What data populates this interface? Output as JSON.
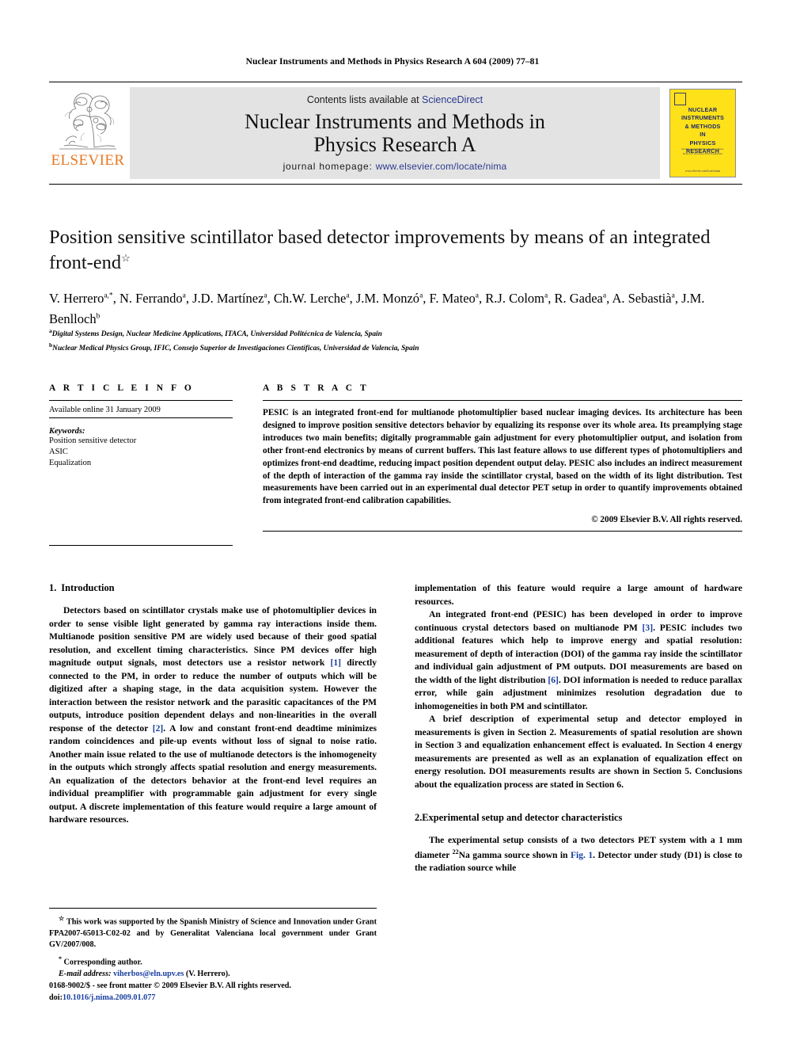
{
  "running_head": "Nuclear Instruments and Methods in Physics Research A 604 (2009) 77–81",
  "masthead": {
    "contents_prefix": "Contents lists available at",
    "sciencedirect": "ScienceDirect",
    "journal_title_line1": "Nuclear Instruments and Methods in",
    "journal_title_line2": "Physics Research A",
    "homepage_label": "journal homepage:",
    "homepage_url": "www.elsevier.com/locate/nima",
    "publisher": "ELSEVIER",
    "cover": {
      "title_line1": "NUCLEAR",
      "title_line2": "INSTRUMENTS",
      "title_line3": "& METHODS",
      "title_line4": "IN",
      "title_line5": "PHYSICS",
      "title_line6": "RESEARCH",
      "subtitle_line1": "Section A: Accelerators, Spectrometers,",
      "subtitle_line2": "Detectors and Associated Equipment",
      "footer": "www.elsevier.com/locate/nima"
    },
    "band_color": "#e3e3e3",
    "link_color": "#2b3a8f",
    "cover_color": "#FFE11A",
    "elsevier_orange": "#E87722"
  },
  "article": {
    "title": "Position sensitive scintillator based detector improvements by means of an integrated front-end",
    "title_star": "☆",
    "authors": "V. Herrero a,*, N. Ferrando a, J.D. Martínez a, Ch.W. Lerche a, J.M. Monzó a, F. Mateo a, R.J. Colom a, R. Gadea a, A. Sebastià a, J.M. Benlloch b",
    "authors_line1_parts": [
      {
        "name": "V. Herrero",
        "sup": "a,*"
      },
      {
        "name": ", N. Ferrando",
        "sup": "a"
      },
      {
        "name": ", J.D. Martínez",
        "sup": "a"
      },
      {
        "name": ", Ch.W. Lerche",
        "sup": "a"
      },
      {
        "name": ", J.M. Monzó",
        "sup": "a"
      },
      {
        "name": ", F. Mateo",
        "sup": "a"
      },
      {
        "name": ", R.J. Colom",
        "sup": "a"
      },
      {
        "name": ",",
        "sup": ""
      }
    ],
    "authors_line2_parts": [
      {
        "name": "R. Gadea",
        "sup": "a"
      },
      {
        "name": ", A. Sebastià",
        "sup": "a"
      },
      {
        "name": ", J.M. Benlloch",
        "sup": "b"
      }
    ],
    "affiliation_a_mark": "a",
    "affiliation_a": "Digital Systems Design, Nuclear Medicine Applications, ITACA, Universidad Politécnica de Valencia, Spain",
    "affiliation_b_mark": "b",
    "affiliation_b": "Nuclear Medical Physics Group, IFIC, Consejo Superior de Investigaciones Científicas, Universidad de Valencia, Spain"
  },
  "article_info": {
    "heading": "A R T I C L E  I N F O",
    "available_online": "Available online 31 January 2009",
    "keywords_label": "Keywords:",
    "keywords": [
      "Position sensitive detector",
      "ASIC",
      "Equalization"
    ]
  },
  "abstract": {
    "heading": "A B S T R A C T",
    "text": "PESIC is an integrated front-end for multianode photomultiplier based nuclear imaging devices. Its architecture has been designed to improve position sensitive detectors behavior by equalizing its response over its whole area. Its preamplying stage introduces two main benefits; digitally programmable gain adjustment for every photomultiplier output, and isolation from other front-end electronics by means of current buffers. This last feature allows to use different types of photomultipliers and optimizes front-end deadtime, reducing impact position dependent output delay. PESIC also includes an indirect measurement of the depth of interaction of the gamma ray inside the scintillator crystal, based on the width of its light distribution. Test measurements have been carried out in an experimental dual detector PET setup in order to quantify improvements obtained from integrated front-end calibration capabilities.",
    "copyright": "© 2009 Elsevier B.V. All rights reserved."
  },
  "sections": {
    "intro_number": "1.",
    "intro_title": "Introduction",
    "intro_p1_a": "Detectors based on scintillator crystals make use of photomultiplier devices in order to sense visible light generated by gamma ray interactions inside them. Multianode position sensitive PM are widely used because of their good spatial resolution, and excellent timing characteristics. Since PM devices offer high magnitude output signals, most detectors use a resistor network ",
    "intro_p1_cite1": "[1]",
    "intro_p1_b": " directly connected to the PM, in order to reduce the number of outputs which will be digitized after a shaping stage, in the data acquisition system. However the interaction between the resistor network and the parasitic capacitances of the PM outputs, introduce position dependent delays and non-linearities in the overall response of the detector ",
    "intro_p1_cite2": "[2]",
    "intro_p1_c": ". A low and constant front-end deadtime minimizes random coincidences and pile-up events without loss of signal to noise ratio. Another main issue related to the use of multianode detectors is the inhomogeneity in the outputs which strongly affects spatial resolution and energy measurements. An equalization of the detectors behavior at the front-end level requires an individual preamplifier with programmable gain adjustment for every single output. A discrete implementation of this feature would require a large amount of hardware resources.",
    "intro_p1_tail": "implementation of this feature would require a large amount of hardware resources.",
    "intro_p2_a": "An integrated front-end (PESIC) has been developed in order to improve continuous crystal detectors based on multianode PM ",
    "intro_p2_cite1": "[3]",
    "intro_p2_b": ". PESIC includes two additional features which help to improve energy and spatial resolution: measurement of depth of interaction (DOI) of the gamma ray inside the scintillator and individual gain adjustment of PM outputs. DOI measurements are based on the width of the light distribution ",
    "intro_p2_cite2": "[6]",
    "intro_p2_c": ". DOI information is needed to reduce parallax error, while gain adjustment minimizes resolution degradation due to inhomogeneities in both PM and scintillator.",
    "intro_p3": "A brief description of experimental setup and detector employed in measurements is given in Section 2. Measurements of spatial resolution are shown in Section 3 and equalization enhancement effect is evaluated. In Section 4 energy measurements are presented as well as an explanation of equalization effect on energy resolution. DOI measurements results are shown in Section 5. Conclusions about the equalization process are stated in Section 6.",
    "setup_number": "2.",
    "setup_title": "Experimental setup and detector characteristics",
    "setup_p1_a": "The experimental setup consists of a two detectors PET system with a 1 mm diameter ",
    "setup_p1_iso": "22",
    "setup_p1_b": "Na gamma source shown in ",
    "setup_p1_fig": "Fig. 1",
    "setup_p1_c": ". Detector under study (D1) is close to the radiation source while"
  },
  "footnotes": {
    "star_mark": "☆",
    "funding": "This work was supported by the Spanish Ministry of Science and Innovation under Grant FPA2007-65013-C02-02 and by Generalitat Valenciana local government under Grant GV/2007/008.",
    "corresponding_mark": "*",
    "corresponding": "Corresponding author.",
    "email_label": "E-mail address:",
    "email": "viherbos@eln.upv.es",
    "email_owner": "(V. Herrero)."
  },
  "footer": {
    "issn_line": "0168-9002/$ - see front matter © 2009 Elsevier B.V. All rights reserved.",
    "doi_label": "doi:",
    "doi": "10.1016/j.nima.2009.01.077"
  },
  "colors": {
    "citation_blue": "#1a3fa0",
    "link_blue": "#2b3a8f"
  }
}
